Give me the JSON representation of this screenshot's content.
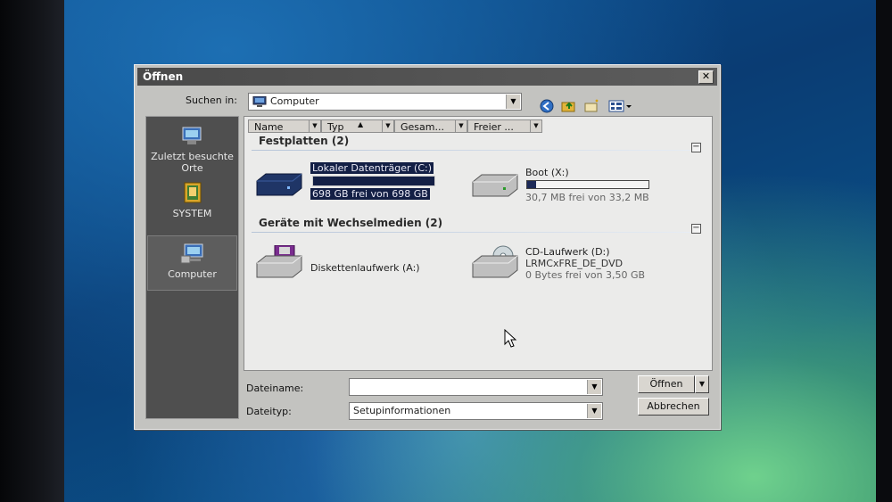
{
  "dialog": {
    "title": "Öffnen",
    "close_symbol": "✕"
  },
  "lookin": {
    "label": "Suchen in:",
    "value": "Computer",
    "icon": "computer-icon"
  },
  "toolbar": {
    "icons": [
      "back-icon",
      "up-folder-icon",
      "new-folder-icon",
      "view-menu-icon"
    ]
  },
  "places": [
    {
      "label": "Zuletzt besuchte Orte",
      "icon": "recent-places-icon"
    },
    {
      "label": "SYSTEM",
      "icon": "user-folder-icon"
    },
    {
      "label": "Computer",
      "icon": "computer-icon",
      "active": true
    }
  ],
  "columns": [
    "Name",
    "Typ",
    "Gesam...",
    "Freier ..."
  ],
  "groups": [
    {
      "title": "Festplatten (2)",
      "items": [
        {
          "name": "Lokaler Datenträger (C:)",
          "info": "698 GB frei von 698 GB",
          "used_fraction": 0.0,
          "selected": true,
          "icon": "hard-drive-icon"
        },
        {
          "name": "Boot (X:)",
          "info": "30,7 MB frei von 33,2 MB",
          "used_fraction": 0.07,
          "selected": false,
          "icon": "hard-drive-icon"
        }
      ]
    },
    {
      "title": "Geräte mit Wechselmedien (2)",
      "items": [
        {
          "name": "Diskettenlaufwerk (A:)",
          "icon": "floppy-drive-icon"
        },
        {
          "name": "CD-Laufwerk (D:)",
          "label": "LRMCxFRE_DE_DVD",
          "info": "0 Bytes frei von 3,50 GB",
          "icon": "cd-drive-icon"
        }
      ]
    }
  ],
  "filename": {
    "label": "Dateiname:",
    "value": ""
  },
  "filetype": {
    "label": "Dateityp:",
    "value": "Setupinformationen"
  },
  "buttons": {
    "open": "Öffnen",
    "cancel": "Abbrechen"
  },
  "colors": {
    "selection": "#131f45",
    "places_bg": "#4f4f4f",
    "dialog_bg": "#c3c3c0"
  }
}
